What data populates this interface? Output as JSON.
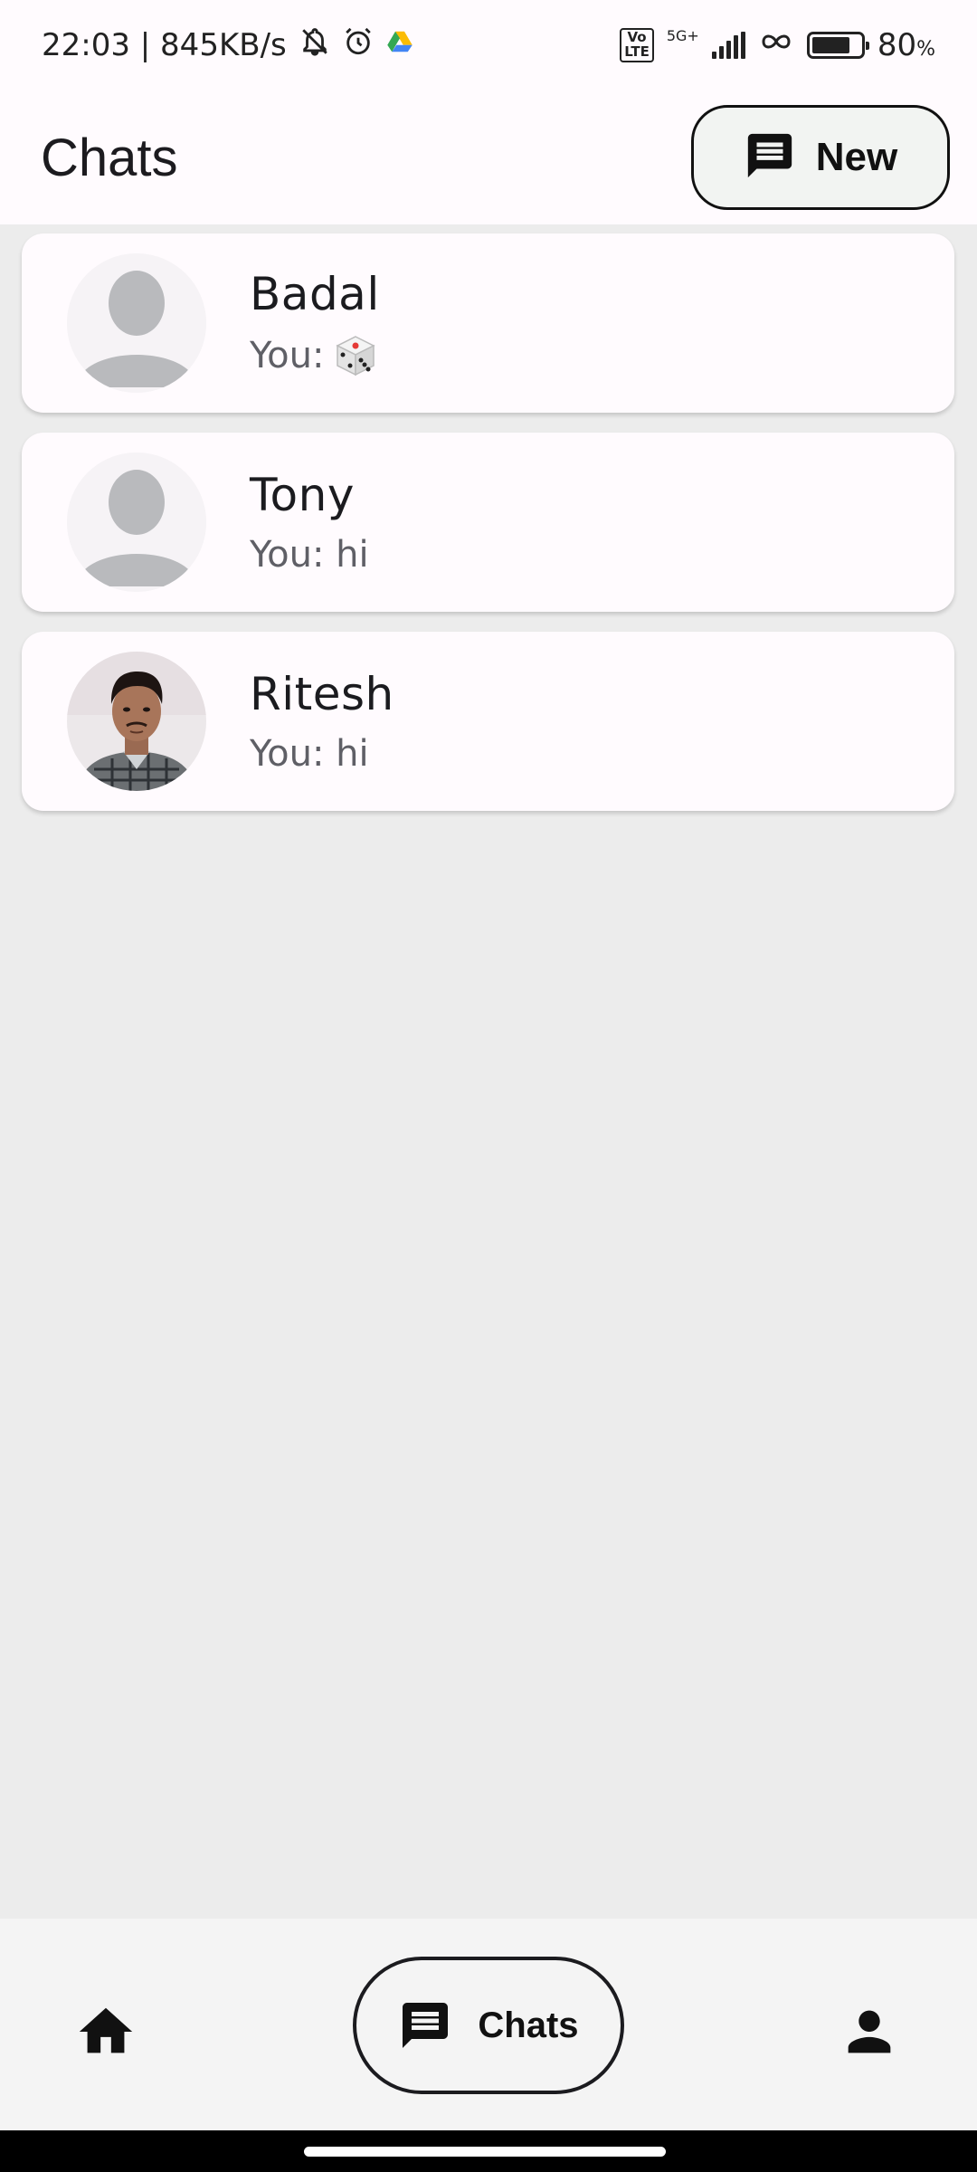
{
  "status_bar": {
    "time_speed": "22:03 | 845KB/s",
    "icons": [
      "mute-bell-icon",
      "alarm-icon",
      "drive-icon",
      "volte-icon",
      "5g-signal-icon",
      "hotspot-icon",
      "battery-icon"
    ],
    "volte_top": "Vo",
    "volte_bottom": "LTE",
    "network": "5G+",
    "battery": "80",
    "battery_unit": "%",
    "battery_level": 0.8
  },
  "app_bar": {
    "title": "Chats",
    "new_button_label": "New"
  },
  "chats": [
    {
      "name": "Badal",
      "preview": "You:",
      "preview_emoji": "🎲",
      "avatar": "placeholder"
    },
    {
      "name": "Tony",
      "preview": "You: hi",
      "avatar": "placeholder"
    },
    {
      "name": "Ritesh",
      "preview": "You: hi",
      "avatar": "photo"
    }
  ],
  "bottom_nav": {
    "items": [
      "home-icon",
      "chats-icon",
      "person-icon"
    ],
    "active_label": "Chats"
  },
  "colors": {
    "surface": "#fffbfe",
    "background": "#ececec",
    "avatar_placeholder": "#b9babd",
    "nav_background": "#f4f4f4"
  }
}
